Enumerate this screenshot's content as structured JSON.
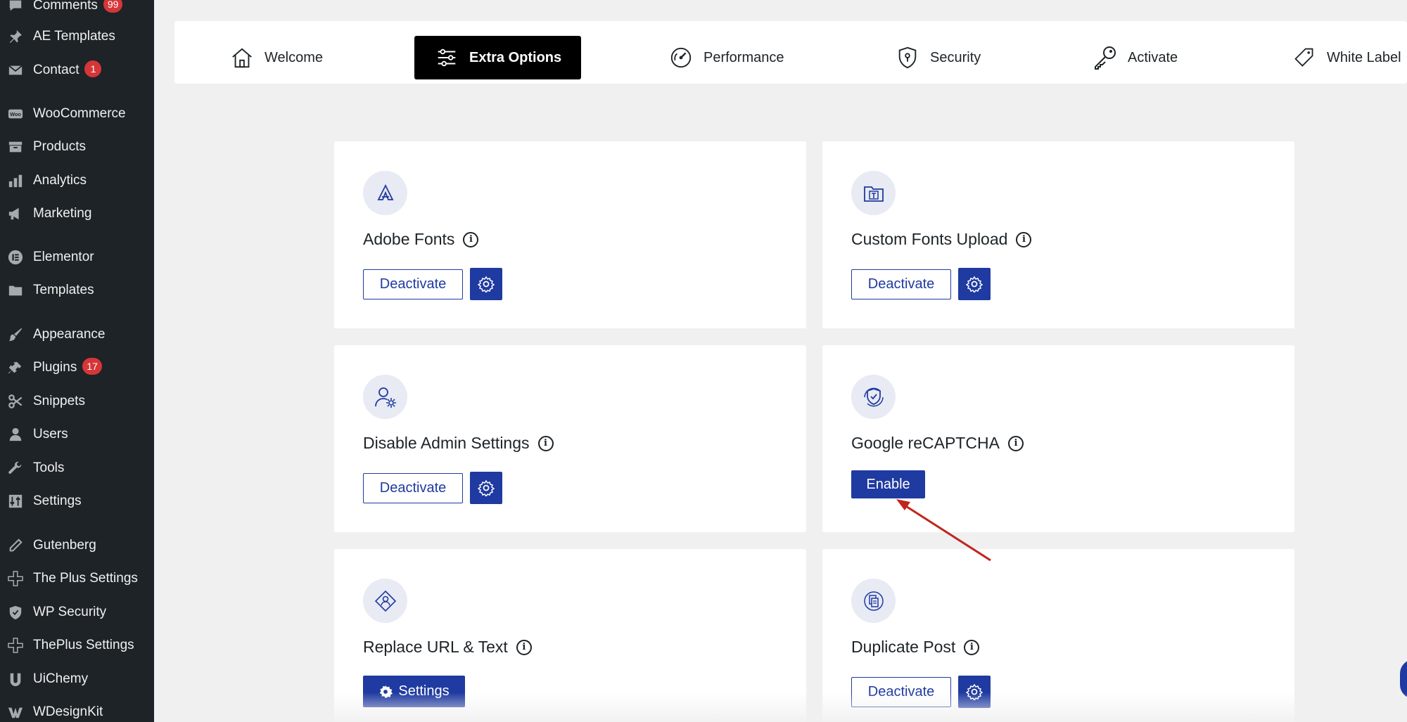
{
  "sidebar": {
    "items": [
      {
        "label": "Comments",
        "badge": "99",
        "icon": "comment-icon"
      },
      {
        "label": "AE Templates",
        "badge": "",
        "icon": "pin-icon"
      },
      {
        "label": "Contact",
        "badge": "1",
        "icon": "envelope-icon"
      },
      {
        "label": "WooCommerce",
        "badge": "",
        "icon": "woo-icon"
      },
      {
        "label": "Products",
        "badge": "",
        "icon": "archive-icon"
      },
      {
        "label": "Analytics",
        "badge": "",
        "icon": "bar-chart-icon"
      },
      {
        "label": "Marketing",
        "badge": "",
        "icon": "megaphone-icon"
      },
      {
        "label": "Elementor",
        "badge": "",
        "icon": "elementor-icon"
      },
      {
        "label": "Templates",
        "badge": "",
        "icon": "folder-icon"
      },
      {
        "label": "Appearance",
        "badge": "",
        "icon": "brush-icon"
      },
      {
        "label": "Plugins",
        "badge": "17",
        "icon": "plug-icon"
      },
      {
        "label": "Snippets",
        "badge": "",
        "icon": "scissors-icon"
      },
      {
        "label": "Users",
        "badge": "",
        "icon": "user-icon"
      },
      {
        "label": "Tools",
        "badge": "",
        "icon": "wrench-icon"
      },
      {
        "label": "Settings",
        "badge": "",
        "icon": "sliders-icon"
      },
      {
        "label": "Gutenberg",
        "badge": "",
        "icon": "pencil-icon"
      },
      {
        "label": "The Plus Settings",
        "badge": "",
        "icon": "plus-icon"
      },
      {
        "label": "WP Security",
        "badge": "",
        "icon": "shield-icon"
      },
      {
        "label": "ThePlus Settings",
        "badge": "",
        "icon": "plus-icon"
      },
      {
        "label": "UiChemy",
        "badge": "",
        "icon": "uichemy-icon"
      },
      {
        "label": "WDesignKit",
        "badge": "",
        "icon": "wdesignkit-icon"
      }
    ]
  },
  "tabs": [
    {
      "label": "Welcome",
      "icon": "home-icon",
      "active": false
    },
    {
      "label": "Extra Options",
      "icon": "sliders-icon",
      "active": true
    },
    {
      "label": "Performance",
      "icon": "speedometer-icon",
      "active": false
    },
    {
      "label": "Security",
      "icon": "shield-icon",
      "active": false
    },
    {
      "label": "Activate",
      "icon": "key-icon",
      "active": false
    },
    {
      "label": "White Label",
      "icon": "tag-icon",
      "active": false
    }
  ],
  "cards": [
    {
      "title": "Adobe Fonts",
      "icon": "adobe-fonts-icon",
      "button": "Deactivate",
      "has_gear": true
    },
    {
      "title": "Custom Fonts Upload",
      "icon": "font-upload-icon",
      "button": "Deactivate",
      "has_gear": true
    },
    {
      "title": "Disable Admin Settings",
      "icon": "user-gear-icon",
      "button": "Deactivate",
      "has_gear": true
    },
    {
      "title": "Google reCAPTCHA",
      "icon": "recaptcha-shield-icon",
      "button": "Enable",
      "has_gear": false
    },
    {
      "title": "Replace URL & Text",
      "icon": "replace-url-icon",
      "button": "Settings",
      "has_gear": false
    },
    {
      "title": "Duplicate Post",
      "icon": "duplicate-icon",
      "button": "Deactivate",
      "has_gear": true
    }
  ],
  "colors": {
    "accent": "#1f3aa0",
    "sidebar_bg": "#1d2327",
    "badge": "#d63638",
    "arrow": "#c0261d"
  }
}
